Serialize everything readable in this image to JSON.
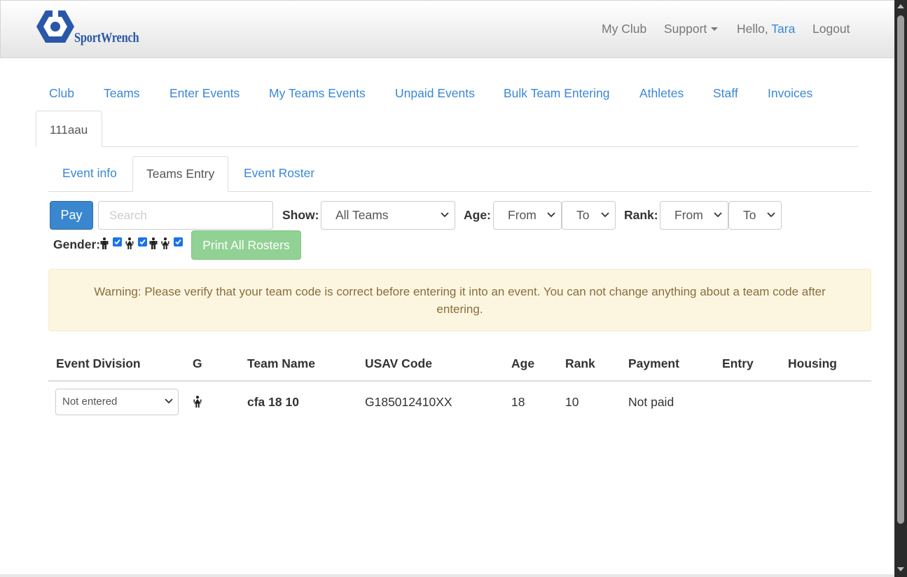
{
  "brand": {
    "name": "SportWrench",
    "logo_icon": "wrench-hex-logo-icon",
    "color": "#2a57a8"
  },
  "navbar": {
    "my_club": "My Club",
    "support": "Support",
    "hello_prefix": "Hello,",
    "user_name": "Tara",
    "logout": "Logout"
  },
  "main_tabs": [
    "Club",
    "Teams",
    "Enter Events",
    "My Teams Events",
    "Unpaid Events",
    "Bulk Team Entering",
    "Athletes",
    "Staff",
    "Invoices"
  ],
  "club_tab": "111aau",
  "sub_tabs": {
    "event_info": "Event info",
    "teams_entry": "Teams Entry",
    "event_roster": "Event Roster",
    "active": "Teams Entry"
  },
  "toolbar": {
    "pay_label": "Pay",
    "search_placeholder": "Search",
    "show_label": "Show:",
    "show_value": "All Teams",
    "age_label": "Age:",
    "age_from": "From",
    "age_to": "To",
    "rank_label": "Rank:",
    "rank_from": "From",
    "rank_to": "To",
    "gender_label": "Gender:",
    "gender_filters": [
      {
        "icon": "male-icon",
        "checked": true
      },
      {
        "icon": "female-icon",
        "checked": true
      },
      {
        "icon": "coed-icon",
        "checked": true
      }
    ],
    "print_label": "Print All Rosters"
  },
  "warning": "Warning: Please verify that your team code is correct before entering it into an event. You can not change anything about a team code after entering.",
  "table": {
    "headers": {
      "division": "Event Division",
      "gender": "G",
      "team_name": "Team Name",
      "usav_code": "USAV Code",
      "age": "Age",
      "rank": "Rank",
      "payment": "Payment",
      "entry": "Entry",
      "housing": "Housing"
    },
    "rows": [
      {
        "division": "Not entered",
        "gender_icon": "female-icon",
        "team_name": "cfa 18 10",
        "usav_code": "G185012410XX",
        "age": "18",
        "rank": "10",
        "payment": "Not paid",
        "entry": "",
        "housing": ""
      }
    ]
  },
  "colors": {
    "link": "#3a87d8",
    "primary": "#3a87d0",
    "success_light": "#92d194",
    "warning_bg": "#fcf6e1",
    "warning_text": "#8a6d3b"
  }
}
